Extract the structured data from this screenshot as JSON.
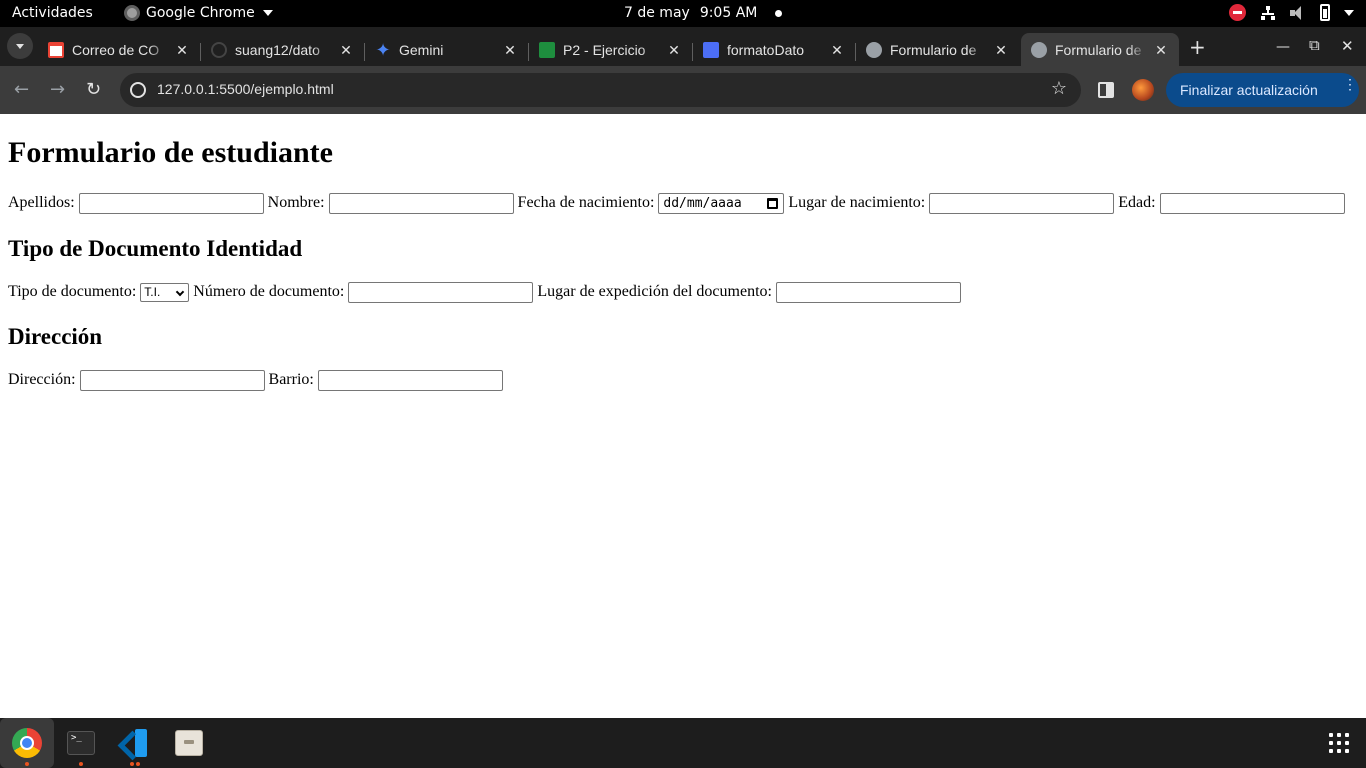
{
  "system_bar": {
    "activities": "Actividades",
    "app_name": "Google Chrome",
    "date": "7 de may",
    "time": "9:05 AM"
  },
  "tabs": [
    {
      "title": "Correo de CO",
      "icon": "gmail-icon"
    },
    {
      "title": "suang12/dato",
      "icon": "github-icon"
    },
    {
      "title": "Gemini",
      "icon": "gemini-icon"
    },
    {
      "title": "P2 - Ejercicio",
      "icon": "classroom-icon"
    },
    {
      "title": "formatoDato",
      "icon": "docs-icon"
    },
    {
      "title": "Formulario de",
      "icon": "globe-icon"
    },
    {
      "title": "Formulario de",
      "icon": "globe-icon",
      "active": true
    }
  ],
  "toolbar": {
    "url": "127.0.0.1:5500/ejemplo.html",
    "update_label": "Finalizar actualización",
    "update_color": "#0b4b8c"
  },
  "page": {
    "title": "Formulario de estudiante",
    "row1": {
      "apellidos_label": "Apellidos:",
      "nombre_label": "Nombre:",
      "fecha_label": "Fecha de nacimiento:",
      "fecha_placeholder": "dd/mm/aaaa",
      "lugar_label": "Lugar de nacimiento:",
      "edad_label": "Edad:"
    },
    "section_doc_title": "Tipo de Documento Identidad",
    "row2": {
      "tipo_label": "Tipo de documento:",
      "tipo_selected": "T.I.",
      "numero_label": "Número de documento:",
      "expedicion_label": "Lugar de expedición del documento:"
    },
    "section_dir_title": "Dirección",
    "row3": {
      "direccion_label": "Dirección:",
      "barrio_label": "Barrio:"
    }
  },
  "dock": {
    "apps": [
      "chrome-icon",
      "terminal-icon",
      "vscode-icon",
      "files-icon",
      "app-grid-icon"
    ]
  }
}
